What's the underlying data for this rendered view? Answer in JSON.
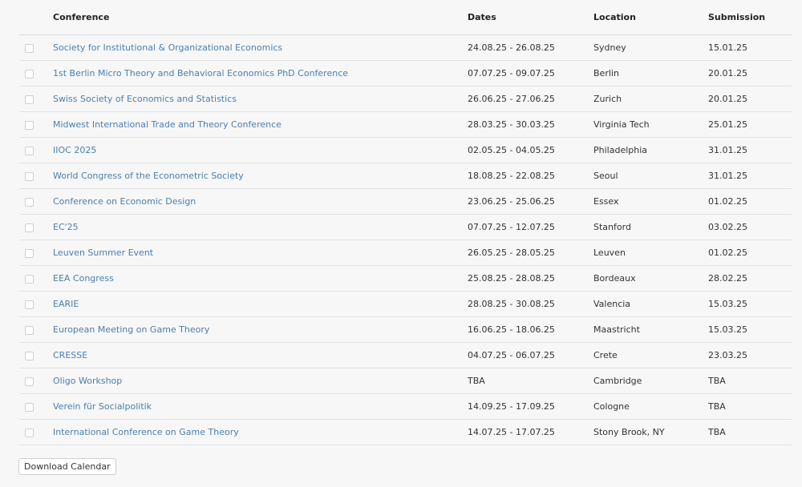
{
  "table": {
    "headers": {
      "conference": "Conference",
      "dates": "Dates",
      "location": "Location",
      "submission": "Submission"
    },
    "rows": [
      {
        "conference": "Society for Institutional & Organizational Economics",
        "dates": "24.08.25 - 26.08.25",
        "location": "Sydney",
        "submission": "15.01.25"
      },
      {
        "conference": "1st Berlin Micro Theory and Behavioral Economics PhD Conference",
        "dates": "07.07.25 - 09.07.25",
        "location": "Berlin",
        "submission": "20.01.25"
      },
      {
        "conference": "Swiss Society of Economics and Statistics",
        "dates": "26.06.25 - 27.06.25",
        "location": "Zurich",
        "submission": "20.01.25"
      },
      {
        "conference": "Midwest International Trade and Theory Conference",
        "dates": "28.03.25 - 30.03.25",
        "location": "Virginia Tech",
        "submission": "25.01.25"
      },
      {
        "conference": "IIOC 2025",
        "dates": "02.05.25 - 04.05.25",
        "location": "Philadelphia",
        "submission": "31.01.25"
      },
      {
        "conference": "World Congress of the Econometric Society",
        "dates": "18.08.25 - 22.08.25",
        "location": "Seoul",
        "submission": "31.01.25"
      },
      {
        "conference": "Conference on Economic Design",
        "dates": "23.06.25 - 25.06.25",
        "location": "Essex",
        "submission": "01.02.25"
      },
      {
        "conference": "EC'25",
        "dates": "07.07.25 - 12.07.25",
        "location": "Stanford",
        "submission": "03.02.25"
      },
      {
        "conference": "Leuven Summer Event",
        "dates": "26.05.25 - 28.05.25",
        "location": "Leuven",
        "submission": "01.02.25"
      },
      {
        "conference": "EEA Congress",
        "dates": "25.08.25 - 28.08.25",
        "location": "Bordeaux",
        "submission": "28.02.25"
      },
      {
        "conference": "EARIE",
        "dates": "28.08.25 - 30.08.25",
        "location": "Valencia",
        "submission": "15.03.25"
      },
      {
        "conference": "European Meeting on Game Theory",
        "dates": "16.06.25 - 18.06.25",
        "location": "Maastricht",
        "submission": "15.03.25"
      },
      {
        "conference": "CRESSE",
        "dates": "04.07.25 - 06.07.25",
        "location": "Crete",
        "submission": "23.03.25"
      },
      {
        "conference": "Oligo Workshop",
        "dates": "TBA",
        "location": "Cambridge",
        "submission": "TBA"
      },
      {
        "conference": "Verein für Socialpolitik",
        "dates": "14.09.25 - 17.09.25",
        "location": "Cologne",
        "submission": "TBA"
      },
      {
        "conference": "International Conference on Game Theory",
        "dates": "14.07.25 - 17.07.25",
        "location": "Stony Brook, NY",
        "submission": "TBA"
      }
    ]
  },
  "download_button": "Download Calendar",
  "colors": {
    "link": "#4a7fb0",
    "background": "#f7f7f7"
  }
}
